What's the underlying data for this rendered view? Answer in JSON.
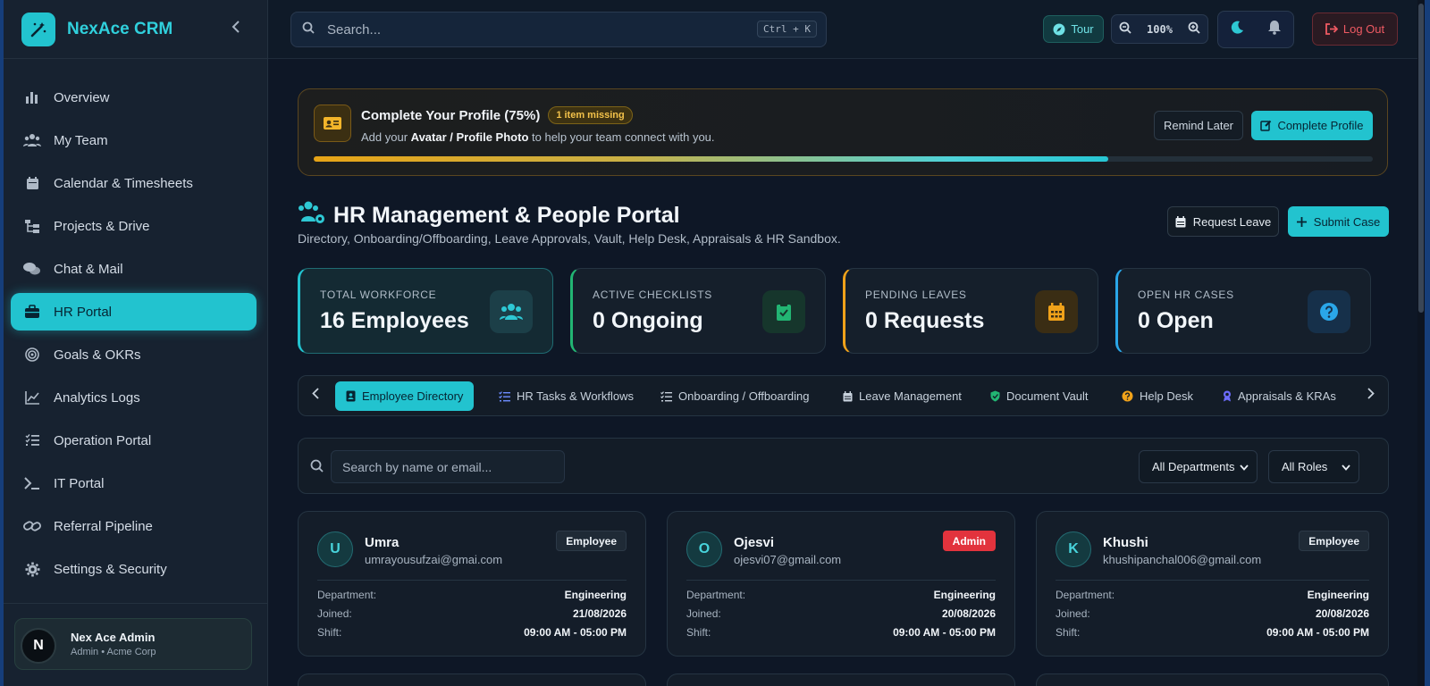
{
  "app": {
    "name": "NexAce CRM"
  },
  "sidebar": {
    "items": [
      {
        "label": "Overview",
        "icon": "bar-chart-icon"
      },
      {
        "label": "My Team",
        "icon": "users-icon"
      },
      {
        "label": "Calendar & Timesheets",
        "icon": "calendar-icon"
      },
      {
        "label": "Projects & Drive",
        "icon": "sitemap-icon"
      },
      {
        "label": "Chat & Mail",
        "icon": "chat-icon"
      },
      {
        "label": "HR Portal",
        "icon": "briefcase-icon"
      },
      {
        "label": "Goals & OKRs",
        "icon": "target-icon"
      },
      {
        "label": "Analytics Logs",
        "icon": "line-chart-icon"
      },
      {
        "label": "Operation Portal",
        "icon": "list-check-icon"
      },
      {
        "label": "IT Portal",
        "icon": "terminal-icon"
      },
      {
        "label": "Referral Pipeline",
        "icon": "link-icon"
      },
      {
        "label": "Settings & Security",
        "icon": "gear-icon"
      }
    ],
    "active": "HR Portal",
    "user": {
      "initial": "N",
      "name": "Nex Ace Admin",
      "role": "Admin • Acme Corp"
    }
  },
  "topbar": {
    "search_placeholder": "Search...",
    "shortcut": "Ctrl + K",
    "tour_label": "Tour",
    "zoom_level": "100%",
    "logout_label": "Log Out"
  },
  "profile_banner": {
    "title": "Complete Your Profile (75%)",
    "badge": "1 item missing",
    "sub_prefix": "Add your",
    "sub_bold": "Avatar / Profile Photo",
    "sub_suffix": "to help your team connect with you.",
    "progress": 0.75,
    "remind_label": "Remind Later",
    "complete_label": "Complete Profile"
  },
  "header": {
    "title": "HR Management & People Portal",
    "subtitle": "Directory, Onboarding/Offboarding, Leave Approvals, Vault, Help Desk, Appraisals & HR Sandbox.",
    "request_leave_label": "Request Leave",
    "submit_case_label": "Submit Case"
  },
  "stats": [
    {
      "label": "TOTAL WORKFORCE",
      "value": "16 Employees",
      "accent": "#22c3cf",
      "icon": "users-icon"
    },
    {
      "label": "ACTIVE CHECKLISTS",
      "value": "0 Ongoing",
      "accent": "#22b573",
      "icon": "clipboard-check-icon"
    },
    {
      "label": "PENDING LEAVES",
      "value": "0 Requests",
      "accent": "#f0a21a",
      "icon": "calendar-icon"
    },
    {
      "label": "OPEN HR CASES",
      "value": "0 Open",
      "accent": "#2aa6e8",
      "icon": "question-icon"
    }
  ],
  "tabs": [
    {
      "label": "Employee Directory",
      "icon": "id-card-icon"
    },
    {
      "label": "HR Tasks & Workflows",
      "icon": "tasks-icon"
    },
    {
      "label": "Onboarding / Offboarding",
      "icon": "checklist-icon"
    },
    {
      "label": "Leave Management",
      "icon": "calendar-icon"
    },
    {
      "label": "Document Vault",
      "icon": "shield-icon"
    },
    {
      "label": "Help Desk",
      "icon": "question-icon"
    },
    {
      "label": "Appraisals & KRAs",
      "icon": "award-icon"
    }
  ],
  "directory": {
    "search_placeholder": "Search by name or email...",
    "department_filter": "All Departments",
    "role_filter": "All Roles",
    "labels": {
      "department": "Department:",
      "joined": "Joined:",
      "shift": "Shift:"
    },
    "employees": [
      {
        "initial": "U",
        "name": "Umra",
        "email": "umrayousufzai@gmai.com",
        "role": "Employee",
        "department": "Engineering",
        "joined": "21/08/2026",
        "shift": "09:00 AM - 05:00 PM"
      },
      {
        "initial": "O",
        "name": "Ojesvi",
        "email": "ojesvi07@gmail.com",
        "role": "Admin",
        "department": "Engineering",
        "joined": "20/08/2026",
        "shift": "09:00 AM - 05:00 PM"
      },
      {
        "initial": "K",
        "name": "Khushi",
        "email": "khushipanchal006@gmail.com",
        "role": "Employee",
        "department": "Engineering",
        "joined": "20/08/2026",
        "shift": "09:00 AM - 05:00 PM"
      }
    ]
  }
}
